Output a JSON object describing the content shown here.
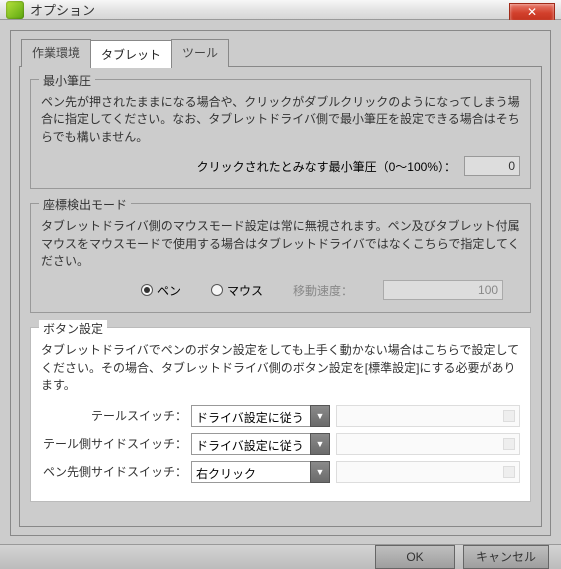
{
  "window": {
    "title": "オプション"
  },
  "tabs": {
    "work_env": "作業環境",
    "tablet": "タブレット",
    "tool": "ツール"
  },
  "pressure": {
    "title": "最小筆圧",
    "desc": "ペン先が押されたままになる場合や、クリックがダブルクリックのようになってしまう場合に指定してください。なお、タブレットドライバ側で最小筆圧を設定できる場合はそちらでも構いません。",
    "label": "クリックされたとみなす最小筆圧（0～100%）：",
    "value": "0"
  },
  "coord": {
    "title": "座標検出モード",
    "desc": "タブレットドライバ側のマウスモード設定は常に無視されます。ペン及びタブレット付属マウスをマウスモードで使用する場合はタブレットドライバではなくこちらで指定してください。",
    "radio_pen": "ペン",
    "radio_mouse": "マウス",
    "speed_label": "移動速度：",
    "speed_value": "100"
  },
  "buttons": {
    "title": "ボタン設定",
    "desc": "タブレットドライバでペンのボタン設定をしても上手く動かない場合はこちらで設定してください。その場合、タブレットドライバ側のボタン設定を[標準設定]にする必要があります。",
    "rows": [
      {
        "label": "テールスイッチ：",
        "value": "ドライバ設定に従う"
      },
      {
        "label": "テール側サイドスイッチ：",
        "value": "ドライバ設定に従う"
      },
      {
        "label": "ペン先側サイドスイッチ：",
        "value": "右クリック"
      }
    ]
  },
  "footer": {
    "ok": "OK",
    "cancel": "キャンセル"
  }
}
